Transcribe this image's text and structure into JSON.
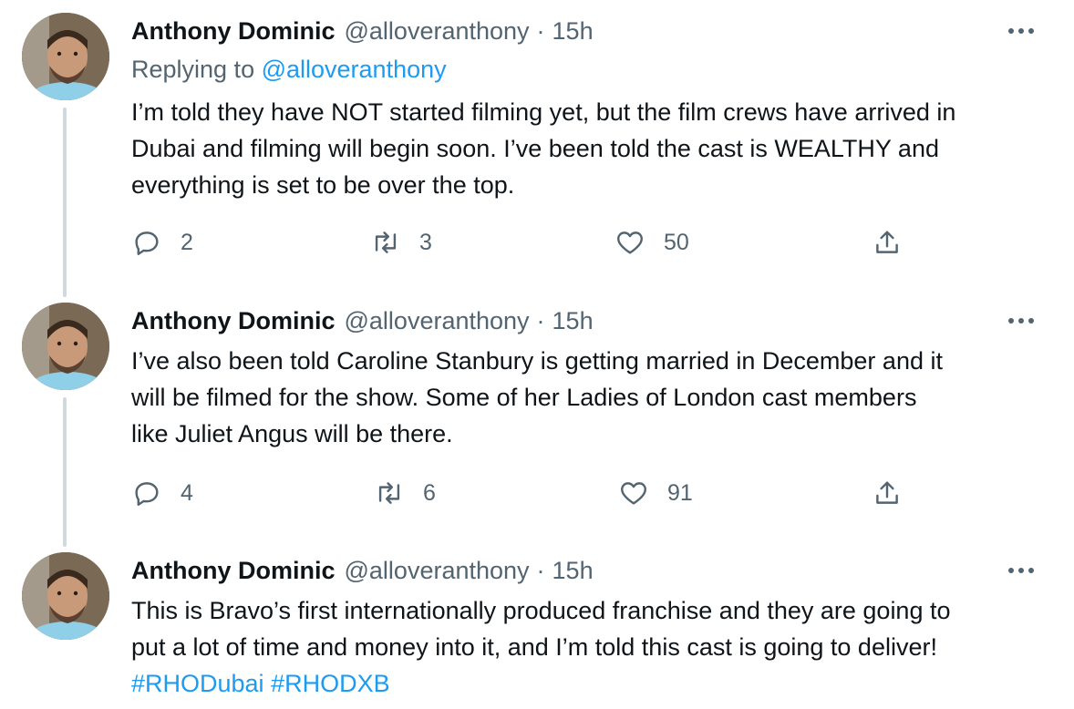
{
  "tweets": [
    {
      "author_name": "Anthony Dominic",
      "handle": "@alloveranthony",
      "separator": "·",
      "time": "15h",
      "replying_prefix": "Replying to ",
      "replying_handle": "@alloveranthony",
      "lines": [
        "I’m told they have NOT started filming yet, but the film crews have arrived in",
        "Dubai and filming will begin soon. I’ve been told the cast is WEALTHY and",
        "everything is set to be over the top."
      ],
      "replies": "2",
      "retweets": "3",
      "likes": "50"
    },
    {
      "author_name": "Anthony Dominic",
      "handle": "@alloveranthony",
      "separator": "·",
      "time": "15h",
      "lines": [
        "I’ve also been told Caroline Stanbury is getting married in December and it",
        "will be filmed for the show. Some of her Ladies of London cast members",
        "like Juliet Angus will be there."
      ],
      "replies": "4",
      "retweets": "6",
      "likes": "91"
    },
    {
      "author_name": "Anthony Dominic",
      "handle": "@alloveranthony",
      "separator": "·",
      "time": "15h",
      "lines": [
        "This is Bravo’s first internationally produced franchise and they are going to",
        "put a lot of time and money into it, and I’m told this cast is going to deliver!"
      ],
      "hashtags": [
        "#RHODubai",
        "#RHODXB"
      ]
    }
  ],
  "icons": {
    "reply": "reply-icon",
    "retweet": "retweet-icon",
    "like": "heart-icon",
    "share": "share-icon",
    "more": "more-icon"
  },
  "colors": {
    "accent": "#1d9bf0",
    "muted": "#536471",
    "thread_line": "#cfd9de"
  }
}
